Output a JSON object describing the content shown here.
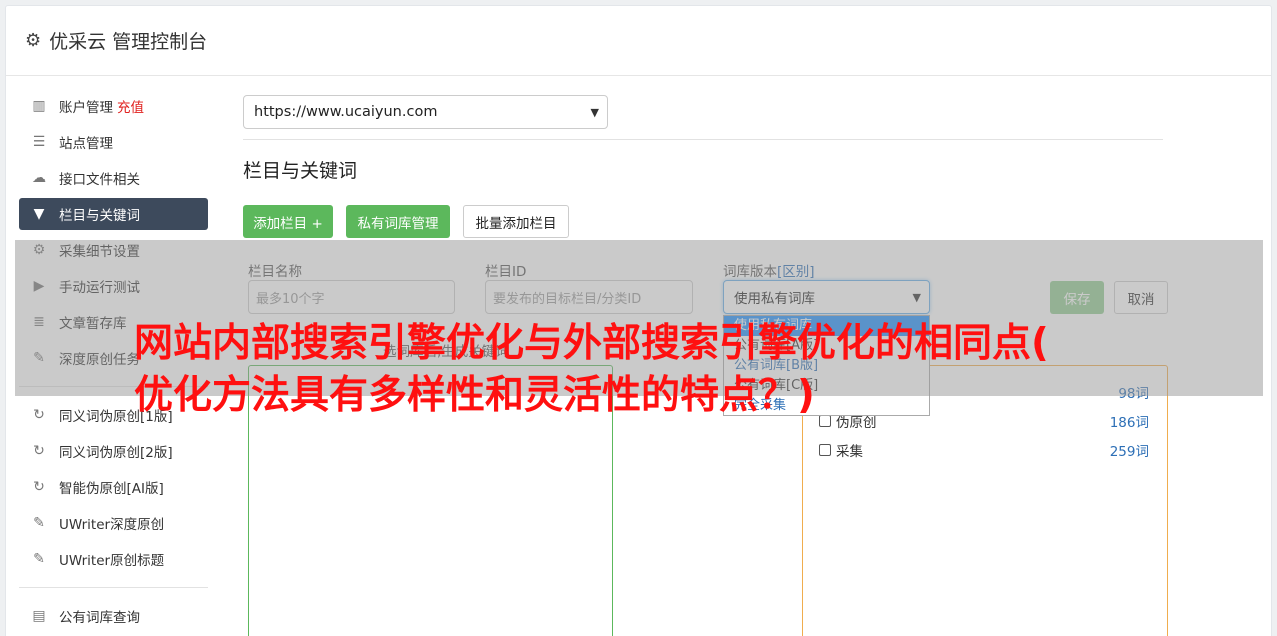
{
  "header": {
    "title": "优采云 管理控制台"
  },
  "sidebar": {
    "group1": [
      {
        "label": "账户管理",
        "icon": "bar-chart-icon",
        "extra": "充值"
      },
      {
        "label": "站点管理",
        "icon": "server-icon"
      },
      {
        "label": "接口文件相关",
        "icon": "cloud-upload-icon"
      },
      {
        "label": "栏目与关键词",
        "icon": "filter-icon",
        "active": true
      },
      {
        "label": "采集细节设置",
        "icon": "cogs-icon"
      },
      {
        "label": "手动运行测试",
        "icon": "play-circle-icon"
      },
      {
        "label": "文章暂存库",
        "icon": "database-icon"
      },
      {
        "label": "深度原创任务",
        "icon": "edit-icon"
      }
    ],
    "group2": [
      {
        "label": "同义词伪原创[1版]",
        "icon": "refresh-icon"
      },
      {
        "label": "同义词伪原创[2版]",
        "icon": "refresh-icon"
      },
      {
        "label": "智能伪原创[AI版]",
        "icon": "refresh-icon"
      },
      {
        "label": "UWriter深度原创",
        "icon": "edit-icon"
      },
      {
        "label": "UWriter原创标题",
        "icon": "edit-icon"
      }
    ],
    "group3": [
      {
        "label": "公有词库查询",
        "icon": "book-icon"
      }
    ]
  },
  "main": {
    "site_select": "https://www.ucaiyun.com",
    "section_title": "栏目与关键词",
    "buttons": {
      "add_column": "添加栏目 +",
      "private_lib": "私有词库管理",
      "batch_add": "批量添加栏目"
    },
    "form": {
      "name_label": "栏目名称",
      "name_placeholder": "最多10个字",
      "id_label": "栏目ID",
      "id_placeholder": "要发布的目标栏目/分类ID",
      "lib_label": "词库版本",
      "lib_label_suffix": "[区别]",
      "lib_value": "使用私有词库",
      "save": "保存",
      "cancel": "取消"
    },
    "dropdown_options": [
      {
        "label": "使用私有词库",
        "selected": true
      },
      {
        "label": "公有词库[A版]"
      },
      {
        "label": "公有词库[B版]"
      },
      {
        "label": "公有词库[C版]"
      },
      {
        "label": "完全采集"
      }
    ],
    "sub_bar": "选词库后,生成关键词",
    "libraries": [
      {
        "label": "",
        "count": "98词"
      },
      {
        "label": "伪原创",
        "count": "186词"
      },
      {
        "label": "采集",
        "count": "259词"
      }
    ]
  },
  "overlay": {
    "headline_line1": "网站内部搜索引擎优化与外部搜索引擎优化的相同点(",
    "headline_line2": "优化方法具有多样性和灵活性的特点？)"
  },
  "colors": {
    "active_sidebar": "#3d4a5c",
    "green": "#5cb85c",
    "orange": "#f0ad4e",
    "headline": "#ff1010",
    "recharge": "#e0201e"
  }
}
